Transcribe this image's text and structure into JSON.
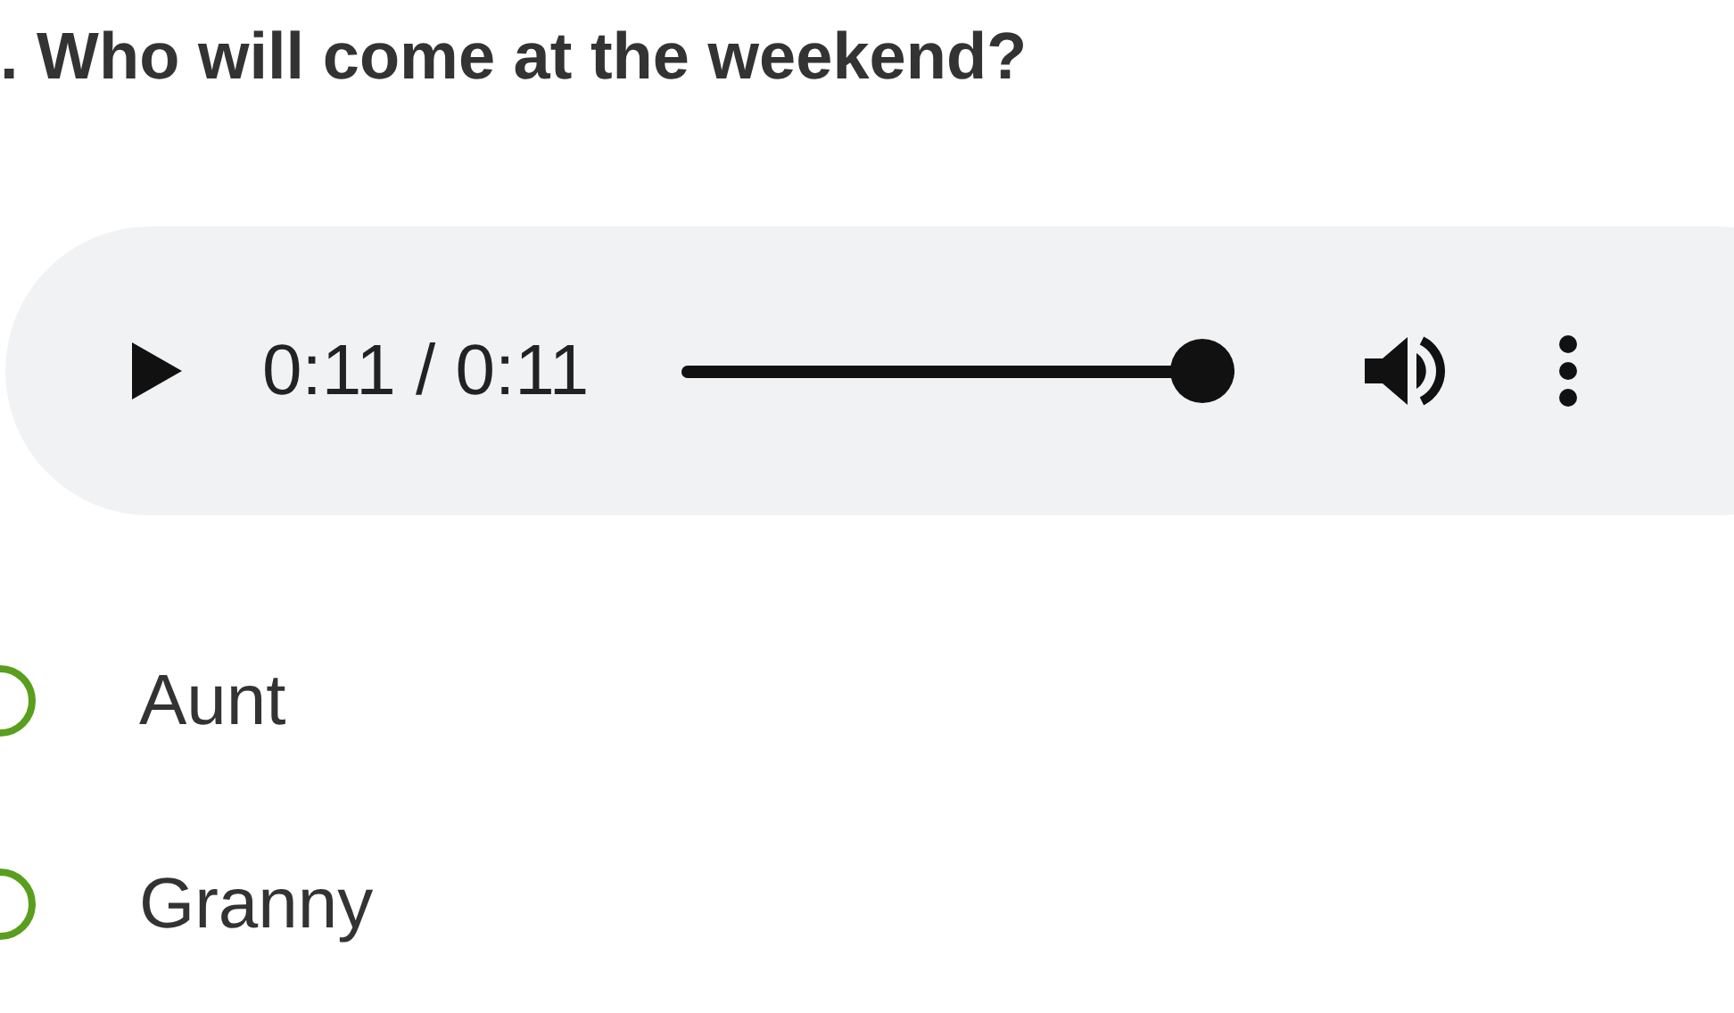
{
  "question": ". Who will come at the weekend?",
  "audio": {
    "time": "0:11 / 0:11",
    "level": 1
  },
  "options": [
    {
      "label": "Aunt",
      "selected": false
    },
    {
      "label": "Granny",
      "selected": false
    }
  ]
}
